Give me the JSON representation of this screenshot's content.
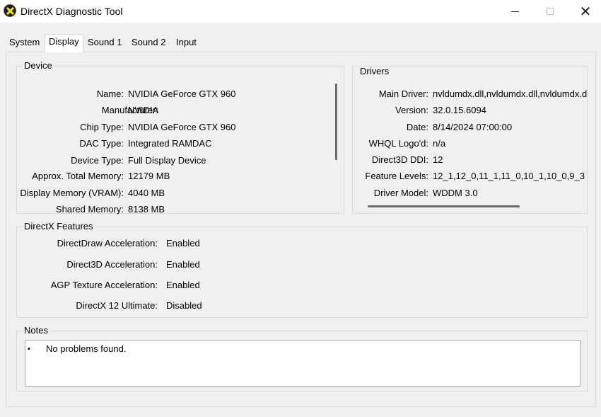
{
  "window": {
    "title": "DirectX Diagnostic Tool",
    "close_glyph": "✕"
  },
  "tabs": [
    {
      "label": "System"
    },
    {
      "label": "Display"
    },
    {
      "label": "Sound 1"
    },
    {
      "label": "Sound 2"
    },
    {
      "label": "Input"
    }
  ],
  "device": {
    "title": "Device",
    "rows": [
      {
        "label": "Name:",
        "value": "NVIDIA GeForce GTX 960"
      },
      {
        "label": "Manufacturer:",
        "value": "NVIDIA"
      },
      {
        "label": "Chip Type:",
        "value": "NVIDIA GeForce GTX 960"
      },
      {
        "label": "DAC Type:",
        "value": "Integrated RAMDAC"
      },
      {
        "label": "Device Type:",
        "value": "Full Display Device"
      },
      {
        "label": "Approx. Total Memory:",
        "value": "12179 MB"
      },
      {
        "label": "Display Memory (VRAM):",
        "value": "4040 MB"
      },
      {
        "label": "Shared Memory:",
        "value": "8138 MB"
      }
    ]
  },
  "drivers": {
    "title": "Drivers",
    "rows": [
      {
        "label": "Main Driver:",
        "value": "nvldumdx.dll,nvldumdx.dll,nvldumdx.d"
      },
      {
        "label": "Version:",
        "value": "32.0.15.6094"
      },
      {
        "label": "Date:",
        "value": "8/14/2024 07:00:00"
      },
      {
        "label": "WHQL Logo'd:",
        "value": "n/a"
      },
      {
        "label": "Direct3D DDI:",
        "value": "12"
      },
      {
        "label": "Feature Levels:",
        "value": "12_1,12_0,11_1,11_0,10_1,10_0,9_3"
      },
      {
        "label": "Driver Model:",
        "value": "WDDM 3.0"
      }
    ]
  },
  "features": {
    "title": "DirectX Features",
    "rows": [
      {
        "label": "DirectDraw Acceleration:",
        "value": "Enabled"
      },
      {
        "label": "Direct3D Acceleration:",
        "value": "Enabled"
      },
      {
        "label": "AGP Texture Acceleration:",
        "value": "Enabled"
      },
      {
        "label": "DirectX 12 Ultimate:",
        "value": "Disabled"
      }
    ]
  },
  "notes": {
    "title": "Notes",
    "bullet": "•",
    "items": [
      "No problems found."
    ]
  }
}
